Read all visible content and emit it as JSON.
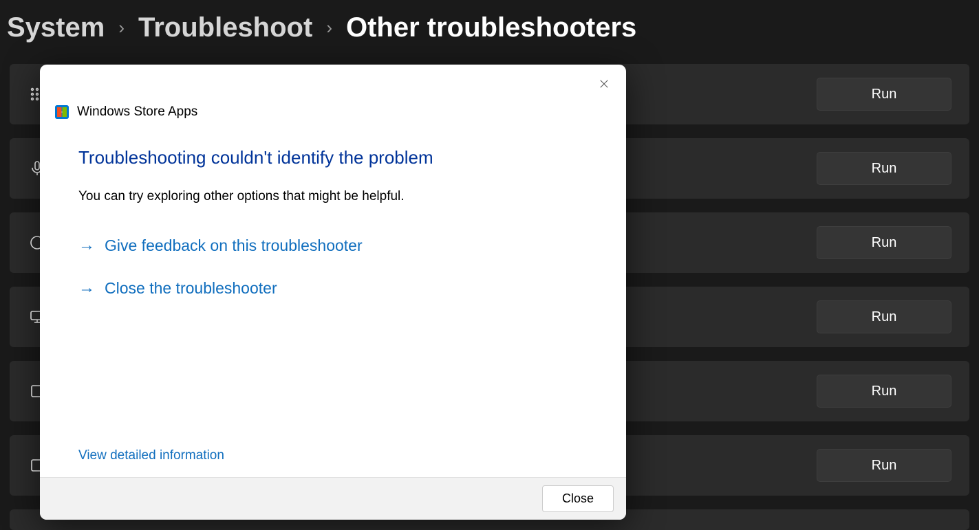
{
  "breadcrumb": {
    "items": [
      {
        "label": "System",
        "current": false
      },
      {
        "label": "Troubleshoot",
        "current": false
      },
      {
        "label": "Other troubleshooters",
        "current": true
      }
    ]
  },
  "troubleshooters": {
    "run_label": "Run",
    "rows": [
      {
        "icon": "grid-icon"
      },
      {
        "icon": "microphone-icon"
      },
      {
        "icon": "circle-icon"
      },
      {
        "icon": "monitor-icon"
      },
      {
        "icon": "square-icon"
      },
      {
        "icon": "square-icon"
      }
    ]
  },
  "dialog": {
    "app_name": "Windows Store Apps",
    "heading": "Troubleshooting couldn't identify the problem",
    "subtext": "You can try exploring other options that might be helpful.",
    "links": {
      "feedback": "Give feedback on this troubleshooter",
      "close": "Close the troubleshooter"
    },
    "detail_link": "View detailed information",
    "close_button": "Close"
  }
}
